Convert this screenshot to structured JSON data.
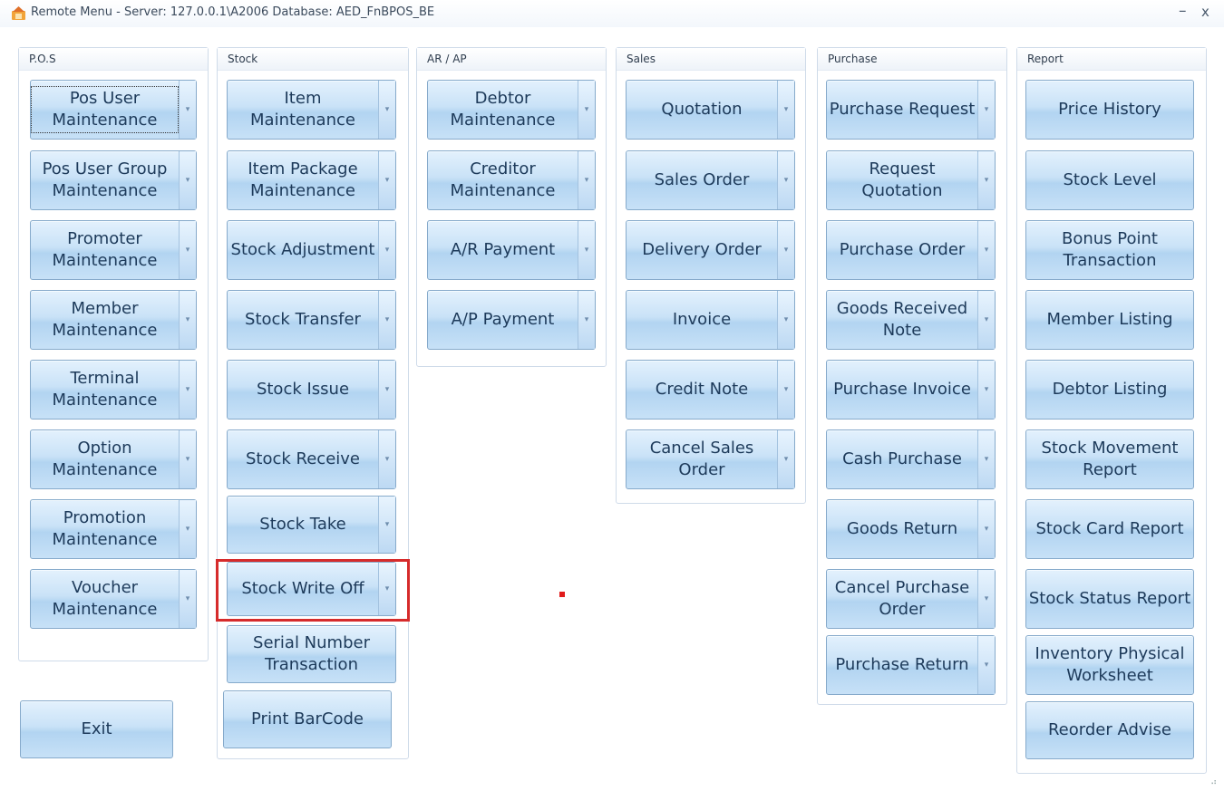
{
  "window": {
    "title": "Remote Menu - Server: 127.0.0.1\\A2006 Database: AED_FnBPOS_BE",
    "minimize_label": "–",
    "close_label": "x"
  },
  "groups": {
    "pos": {
      "title": "P.O.S",
      "buttons": [
        "Pos User Maintenance",
        "Pos User Group Maintenance",
        "Promoter Maintenance",
        "Member Maintenance",
        "Terminal Maintenance",
        "Option Maintenance",
        "Promotion Maintenance",
        "Voucher Maintenance"
      ]
    },
    "stock": {
      "title": "Stock",
      "buttons": [
        "Item Maintenance",
        "Item Package Maintenance",
        "Stock Adjustment",
        "Stock Transfer",
        "Stock Issue",
        "Stock Receive",
        "Stock Take",
        "Stock Write Off",
        "Serial Number Transaction",
        "Print BarCode"
      ]
    },
    "arap": {
      "title": "AR / AP",
      "buttons": [
        "Debtor Maintenance",
        "Creditor Maintenance",
        "A/R Payment",
        "A/P Payment"
      ]
    },
    "sales": {
      "title": "Sales",
      "buttons": [
        "Quotation",
        "Sales Order",
        "Delivery Order",
        "Invoice",
        "Credit Note",
        "Cancel Sales Order"
      ]
    },
    "purchase": {
      "title": "Purchase",
      "buttons": [
        "Purchase Request",
        "Request Quotation",
        "Purchase Order",
        "Goods Received Note",
        "Purchase Invoice",
        "Cash Purchase",
        "Goods Return",
        "Cancel Purchase Order",
        "Purchase Return"
      ]
    },
    "report": {
      "title": "Report",
      "buttons": [
        "Price History",
        "Stock Level",
        "Bonus Point Transaction",
        "Member Listing",
        "Debtor Listing",
        "Stock Movement Report",
        "Stock Card Report",
        "Stock Status Report",
        "Inventory Physical Worksheet",
        "Reorder Advise"
      ]
    }
  },
  "exit_label": "Exit",
  "icons": {
    "app": "app-icon",
    "dropdown": "dropdown-arrow-icon"
  },
  "colors": {
    "highlight": "#d62b2b",
    "button_top": "#e3f1fd",
    "button_bottom": "#b2d4f1"
  }
}
